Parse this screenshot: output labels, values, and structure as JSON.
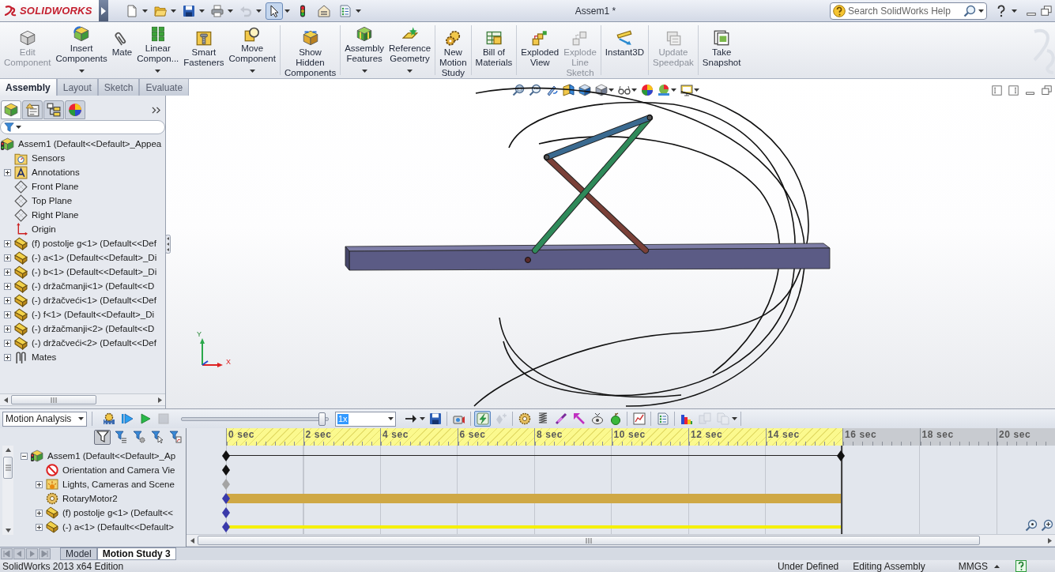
{
  "title_bar": {
    "logo": "SOLIDWORKS",
    "quick_access": [
      {
        "kind": "new",
        "dropdown": true,
        "disabled": false
      },
      {
        "kind": "open",
        "dropdown": true,
        "disabled": false
      },
      {
        "kind": "save",
        "dropdown": true,
        "disabled": false
      },
      {
        "kind": "print",
        "dropdown": true,
        "disabled": false
      },
      {
        "kind": "undo",
        "dropdown": true,
        "disabled": true
      },
      {
        "kind": "select",
        "dropdown": true,
        "disabled": false,
        "selected": true
      },
      {
        "kind": "rebuild",
        "dropdown": false,
        "disabled": false
      },
      {
        "kind": "options",
        "dropdown": false,
        "disabled": false
      },
      {
        "kind": "checklist",
        "dropdown": true,
        "disabled": false
      }
    ],
    "title": "Assem1 *",
    "search": {
      "placeholder": "Search SolidWorks Help"
    }
  },
  "ribbon": {
    "groups": [
      {
        "commands": [
          {
            "label": "Edit\nComponent",
            "disabled": true,
            "dropdown": false
          },
          {
            "label": "Insert\nComponents",
            "disabled": false,
            "dropdown": true
          },
          {
            "label": "Mate",
            "disabled": false,
            "dropdown": false
          },
          {
            "label": "Linear\nCompon...",
            "disabled": false,
            "dropdown": true
          },
          {
            "label": "Smart\nFasteners",
            "disabled": false,
            "dropdown": false
          },
          {
            "label": "Move\nComponent",
            "disabled": false,
            "dropdown": true
          }
        ]
      },
      {
        "commands": [
          {
            "label": "Show\nHidden\nComponents",
            "disabled": false,
            "dropdown": false
          }
        ]
      },
      {
        "commands": [
          {
            "label": "Assembly\nFeatures",
            "disabled": false,
            "dropdown": true
          },
          {
            "label": "Reference\nGeometry",
            "disabled": false,
            "dropdown": true
          }
        ]
      },
      {
        "commands": [
          {
            "label": "New\nMotion\nStudy",
            "disabled": false,
            "dropdown": false
          }
        ]
      },
      {
        "commands": [
          {
            "label": "Bill of\nMaterials",
            "disabled": false,
            "dropdown": false
          }
        ]
      },
      {
        "commands": [
          {
            "label": "Exploded\nView",
            "disabled": false,
            "dropdown": false
          },
          {
            "label": "Explode\nLine\nSketch",
            "disabled": true,
            "dropdown": false
          }
        ]
      },
      {
        "commands": [
          {
            "label": "Instant3D",
            "disabled": false,
            "dropdown": false
          }
        ]
      },
      {
        "commands": [
          {
            "label": "Update\nSpeedpak",
            "disabled": true,
            "dropdown": false
          }
        ]
      },
      {
        "commands": [
          {
            "label": "Take\nSnapshot",
            "disabled": false,
            "dropdown": false
          }
        ]
      }
    ]
  },
  "command_tabs": [
    {
      "label": "Assembly",
      "selected": true
    },
    {
      "label": "Layout",
      "selected": false
    },
    {
      "label": "Sketch",
      "selected": false
    },
    {
      "label": "Evaluate",
      "selected": false
    }
  ],
  "feature_manager": {
    "panel_tabs": [
      {
        "selected": true
      },
      {
        "selected": false
      },
      {
        "selected": false
      },
      {
        "selected": false
      }
    ],
    "tree": {
      "label": "Assem1 (Default<<Default>_Appea",
      "kind": "assembly",
      "children": [
        {
          "label": "Sensors",
          "kind": "sensor-folder"
        },
        {
          "label": "Annotations",
          "kind": "annotation-folder",
          "expanded": false
        },
        {
          "label": "Front Plane",
          "kind": "plane"
        },
        {
          "label": "Top Plane",
          "kind": "plane"
        },
        {
          "label": "Right Plane",
          "kind": "plane"
        },
        {
          "label": "Origin",
          "kind": "origin"
        },
        {
          "label": "(f) postolje g<1> (Default<<Def",
          "kind": "part",
          "expanded": false
        },
        {
          "label": "(-) a<1> (Default<<Default>_Di",
          "kind": "part",
          "expanded": false
        },
        {
          "label": "(-) b<1> (Default<<Default>_Di",
          "kind": "part",
          "expanded": false
        },
        {
          "label": "(-) držačmanji<1> (Default<<D",
          "kind": "part",
          "expanded": false
        },
        {
          "label": "(-) držačveći<1> (Default<<Def",
          "kind": "part",
          "expanded": false
        },
        {
          "label": "(-) f<1> (Default<<Default>_Di",
          "kind": "part",
          "expanded": false
        },
        {
          "label": "(-) držačmanji<2> (Default<<D",
          "kind": "part",
          "expanded": false
        },
        {
          "label": "(-) držačveći<2> (Default<<Def",
          "kind": "part",
          "expanded": false
        },
        {
          "label": "Mates",
          "kind": "mates",
          "expanded": false
        }
      ]
    }
  },
  "viewport": {
    "view_tools": [
      {
        "kind": "zoom-to-fit",
        "dropdown": false
      },
      {
        "kind": "zoom-area",
        "dropdown": false
      },
      {
        "kind": "previous-view",
        "dropdown": false
      },
      {
        "kind": "section-view",
        "dropdown": false
      },
      {
        "kind": "view-orientation",
        "dropdown": false
      },
      {
        "kind": "display-style",
        "dropdown": true
      },
      {
        "kind": "hide-show",
        "dropdown": true
      },
      {
        "kind": "edit-appearance",
        "dropdown": false
      },
      {
        "kind": "apply-scene",
        "dropdown": true
      },
      {
        "kind": "view-settings",
        "dropdown": true
      }
    ],
    "triad": {
      "y": "Y",
      "x": "X"
    }
  },
  "motion_manager": {
    "study_type": "Motion Analysis",
    "playback": [
      {
        "kind": "calculate",
        "disabled": false,
        "selected": false,
        "dropdown": false
      },
      {
        "kind": "play-from-start",
        "disabled": false,
        "selected": false,
        "dropdown": false
      },
      {
        "kind": "play",
        "disabled": false,
        "selected": false,
        "dropdown": false
      },
      {
        "kind": "stop",
        "disabled": true,
        "selected": false,
        "dropdown": false
      }
    ],
    "slider": {
      "level": 0.96
    },
    "speed": "1x",
    "tool_groups": [
      {
        "tools": [
          {
            "kind": "playback-mode",
            "disabled": false,
            "selected": false,
            "dropdown": true
          },
          {
            "kind": "save-animation",
            "disabled": false,
            "selected": false,
            "dropdown": false
          }
        ]
      },
      {
        "tools": [
          {
            "kind": "animation-wizard",
            "disabled": false,
            "selected": false,
            "dropdown": false
          }
        ]
      },
      {
        "tools": [
          {
            "kind": "autokey",
            "disabled": false,
            "selected": true,
            "dropdown": false
          },
          {
            "kind": "add-key",
            "disabled": true,
            "selected": false,
            "dropdown": false
          }
        ]
      },
      {
        "tools": [
          {
            "kind": "motor",
            "disabled": false,
            "selected": false,
            "dropdown": false
          },
          {
            "kind": "spring",
            "disabled": false,
            "selected": false,
            "dropdown": false
          },
          {
            "kind": "damper",
            "disabled": false,
            "selected": false,
            "dropdown": false
          },
          {
            "kind": "force",
            "disabled": false,
            "selected": false,
            "dropdown": false
          },
          {
            "kind": "contact",
            "disabled": false,
            "selected": false,
            "dropdown": false
          },
          {
            "kind": "gravity",
            "disabled": false,
            "selected": false,
            "dropdown": false
          }
        ]
      },
      {
        "tools": [
          {
            "kind": "results",
            "disabled": false,
            "selected": false,
            "dropdown": false
          }
        ]
      },
      {
        "tools": [
          {
            "kind": "properties",
            "disabled": false,
            "selected": false,
            "dropdown": false
          }
        ]
      },
      {
        "tools": [
          {
            "kind": "color-plot",
            "disabled": false,
            "selected": false,
            "dropdown": false
          },
          {
            "kind": "collapse",
            "disabled": true,
            "selected": false,
            "dropdown": false
          },
          {
            "kind": "view",
            "disabled": true,
            "selected": false,
            "dropdown": true
          }
        ]
      }
    ],
    "filters": [
      {
        "selected": true
      },
      {
        "selected": false
      },
      {
        "selected": false
      },
      {
        "selected": false
      },
      {
        "selected": false
      }
    ],
    "tree": {
      "label": "Assem1 (Default<<Default>_Ap",
      "kind": "assembly",
      "expanded": true,
      "key": {
        "color": "#111111"
      },
      "track": {
        "kind": "span"
      },
      "children": [
        {
          "label": "Orientation and Camera Vie",
          "kind": "view-orientation",
          "key": {
            "color": "#111111"
          }
        },
        {
          "label": "Lights, Cameras and Scene",
          "kind": "lights",
          "expanded": false,
          "key": {
            "color": "#a4a4a4"
          }
        },
        {
          "label": "RotaryMotor2",
          "kind": "motor",
          "key": {
            "color": "#3a3aaa"
          },
          "track": {
            "kind": "bar"
          }
        },
        {
          "label": "(f) postolje g<1> (Default<<",
          "kind": "part",
          "expanded": false,
          "key": {
            "color": "#3a3aaa"
          }
        },
        {
          "label": "(-) a<1> (Default<<Default>",
          "kind": "part",
          "expanded": false,
          "key": {
            "color": "#3a3aaa"
          },
          "track": {
            "kind": "line"
          }
        }
      ]
    },
    "ticks": [
      {
        "label": "0 sec",
        "in_range": true
      },
      {
        "label": "2 sec",
        "in_range": true
      },
      {
        "label": "4 sec",
        "in_range": true
      },
      {
        "label": "6 sec",
        "in_range": true
      },
      {
        "label": "8 sec",
        "in_range": true
      },
      {
        "label": "10 sec",
        "in_range": true
      },
      {
        "label": "12 sec",
        "in_range": true
      },
      {
        "label": "14 sec",
        "in_range": true
      },
      {
        "label": "16 sec",
        "in_range": false
      },
      {
        "label": "18 sec",
        "in_range": false
      },
      {
        "label": "20 sec",
        "in_range": false
      }
    ]
  },
  "study_tabs": [
    {
      "label": "Model",
      "selected": false
    },
    {
      "label": "Motion Study 3",
      "selected": true
    }
  ],
  "status_bar": {
    "edition": "SolidWorks 2013 x64 Edition",
    "definition": "Under Defined",
    "mode": "Editing Assembly",
    "units": "MMGS"
  }
}
